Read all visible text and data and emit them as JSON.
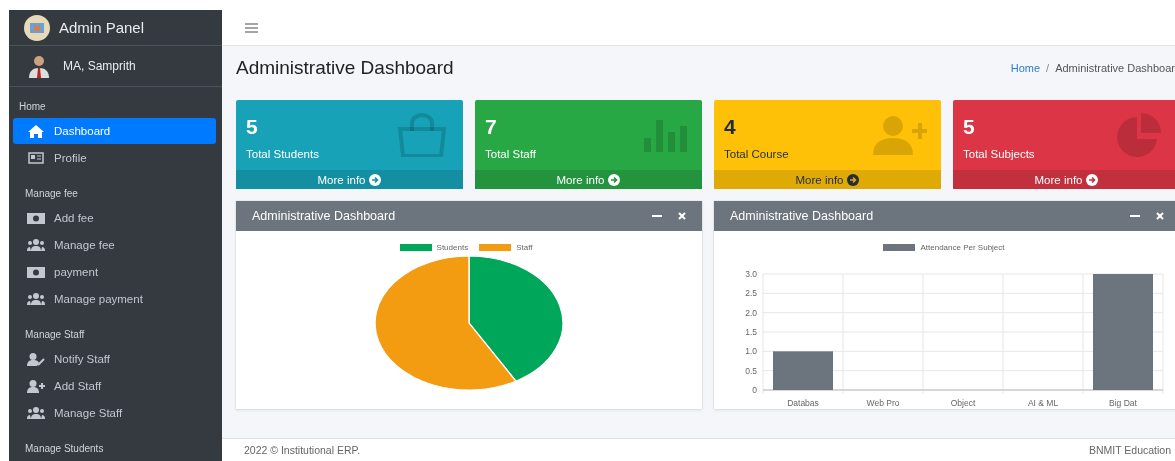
{
  "brand": {
    "title": "Admin Panel"
  },
  "user": {
    "name": "MA, Samprith"
  },
  "sidebar": {
    "sections": [
      {
        "label": "Home",
        "items": [
          {
            "label": "Dashboard",
            "kind": "home",
            "selected": true
          },
          {
            "label": "Profile",
            "kind": "card",
            "selected": false
          }
        ]
      },
      {
        "label": "Manage fee",
        "items": [
          {
            "label": "Add fee",
            "kind": "money",
            "selected": false
          },
          {
            "label": "Manage fee",
            "kind": "group",
            "selected": false
          },
          {
            "label": "payment",
            "kind": "money",
            "selected": false
          },
          {
            "label": "Manage payment",
            "kind": "group",
            "selected": false
          }
        ]
      },
      {
        "label": "Manage Staff",
        "items": [
          {
            "label": "Notify Staff",
            "kind": "user-edit",
            "selected": false
          },
          {
            "label": "Add Staff",
            "kind": "user-add",
            "selected": false
          },
          {
            "label": "Manage Staff",
            "kind": "group",
            "selected": false
          }
        ]
      },
      {
        "label": "Manage Students"
      }
    ]
  },
  "page": {
    "title": "Administrative Dashboard",
    "breadcrumb": [
      "Home",
      "Administrative Dashboar"
    ],
    "breadcrumb_separator": "/"
  },
  "stat_cards": [
    {
      "value": "5",
      "label": "Total Students",
      "link": "More info",
      "kind": "bag",
      "color": "#17a2b8"
    },
    {
      "value": "7",
      "label": "Total Staff",
      "link": "More info",
      "kind": "bars",
      "color": "#28a745"
    },
    {
      "value": "4",
      "label": "Total Course",
      "link": "More info",
      "kind": "user-add",
      "color": "#ffc107"
    },
    {
      "value": "5",
      "label": "Total Subjects",
      "link": "More info",
      "kind": "pie",
      "color": "#dc3545"
    }
  ],
  "panels": [
    {
      "title": "Administrative Dashboard",
      "chart_data": {
        "type": "pie",
        "categories": [
          "Students",
          "Staff"
        ],
        "series": [
          {
            "values": [
              41.7,
              58.3
            ]
          }
        ],
        "colors": [
          "#00a65a",
          "#f39c12"
        ],
        "legend": "top"
      }
    },
    {
      "title": "Administrative Dashboard",
      "chart_data": {
        "type": "bar",
        "categories": [
          "Databas",
          "Web Pro",
          "Object",
          "AI & ML",
          "Big Dat"
        ],
        "series": [
          {
            "name": "Attendance Per Subject",
            "color": "#6c757d",
            "values": [
              1,
              0,
              0,
              0,
              3
            ]
          }
        ],
        "ylim": [
          0,
          3
        ],
        "yticks": [
          0,
          0.5,
          {
            "value": 1,
            "label": "1.0"
          },
          1.5,
          {
            "value": 2,
            "label": "2.0"
          },
          2.5,
          {
            "value": 3,
            "label": "3.0"
          }
        ],
        "legend": "top",
        "grid": true
      }
    }
  ],
  "footer": {
    "left": "2022 © Institutional ERP.",
    "right": "BNMIT Education"
  }
}
